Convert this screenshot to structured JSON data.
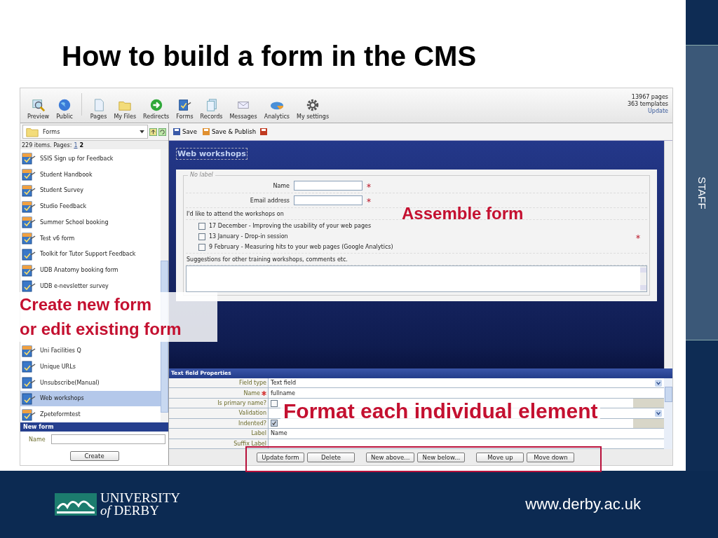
{
  "slide": {
    "title": "How to build a form in the CMS",
    "side_label": "STAFF",
    "logo_line1": "UNIVERSITY",
    "logo_line2": "*of* DERBY",
    "url": "www.derby.ac.uk"
  },
  "toolbar": {
    "buttons": [
      {
        "label": "Preview",
        "kind": "preview"
      },
      {
        "label": "Public",
        "kind": "globe"
      },
      {
        "label": "Pages",
        "kind": "page"
      },
      {
        "label": "My Files",
        "kind": "folder"
      },
      {
        "label": "Redirects",
        "kind": "redirect"
      },
      {
        "label": "Forms",
        "kind": "form"
      },
      {
        "label": "Records",
        "kind": "records"
      },
      {
        "label": "Messages",
        "kind": "mail"
      },
      {
        "label": "Analytics",
        "kind": "analytics"
      },
      {
        "label": "My settings",
        "kind": "gear"
      }
    ],
    "stats": [
      "13967 pages",
      "363 templates"
    ],
    "update_link": "Update"
  },
  "folder_select": {
    "value": "Forms"
  },
  "editor_toolbar": [
    "Save",
    "Save & Publish"
  ],
  "list": {
    "summary": "229 items. Pages:",
    "pages": [
      {
        "label": "1",
        "selected": false
      },
      {
        "label": "2",
        "selected": true
      }
    ],
    "items": [
      {
        "label": "SSIS Sign up for Feedback",
        "kind": "tabbed",
        "selected": false
      },
      {
        "label": "Student Handbook",
        "kind": "tabbed",
        "selected": false
      },
      {
        "label": "Student Survey",
        "kind": "tabbed",
        "selected": false
      },
      {
        "label": "Studio Feedback",
        "kind": "tabbed",
        "selected": false
      },
      {
        "label": "Summer School booking",
        "kind": "tabbed",
        "selected": false
      },
      {
        "label": "Test v6 form",
        "kind": "tabbed",
        "selected": false
      },
      {
        "label": "Toolkit for Tutor Support Feedback",
        "kind": "plain",
        "selected": false
      },
      {
        "label": "UDB Anatomy booking form",
        "kind": "tabbed",
        "selected": false
      },
      {
        "label": "UDB e-nevsletter survey",
        "kind": "plain",
        "selected": false
      },
      {
        "label": "Uni Facilities Q",
        "kind": "tabbed",
        "selected": false
      },
      {
        "label": "Unique URLs",
        "kind": "plain",
        "selected": false
      },
      {
        "label": "Unsubscribe(Manual)",
        "kind": "plain",
        "selected": false
      },
      {
        "label": "Web workshops",
        "kind": "plain",
        "selected": true
      },
      {
        "label": "Zpeteformtest",
        "kind": "tabbed",
        "selected": false
      }
    ]
  },
  "new_form": {
    "title": "New form",
    "name_label": "Name",
    "button": "Create"
  },
  "form_preview": {
    "title": "Web workshops",
    "legend": "No label",
    "fields": [
      {
        "label": "Name",
        "required": true
      },
      {
        "label": "Email address",
        "required": true
      }
    ],
    "question": "I'd like to attend the workshops on",
    "question_required": true,
    "options": [
      {
        "label": "17 December - Improving the usability of your web pages",
        "checked": false
      },
      {
        "label": "13 January - Drop-in session",
        "checked": false
      },
      {
        "label": "9 February - Measuring hits to your web pages (Google Analytics)",
        "checked": false
      }
    ],
    "suggestions_label": "Suggestions for other training workshops, comments etc."
  },
  "properties": {
    "title": "Text field Properties",
    "rows": [
      {
        "label": "Field type",
        "kind": "select",
        "value": "Text field",
        "required": false
      },
      {
        "label": "Name",
        "kind": "text",
        "value": "fullname",
        "required": true
      },
      {
        "label": "Is primary name?",
        "kind": "checkbox",
        "checked": false,
        "required": false
      },
      {
        "label": "Validation",
        "kind": "select",
        "required": false
      },
      {
        "label": "Indented?",
        "kind": "checkbox",
        "checked": true,
        "required": false
      },
      {
        "label": "Label",
        "kind": "text",
        "value": "Name",
        "required": false
      },
      {
        "label": "Suffix Label",
        "kind": "text",
        "required": false
      }
    ]
  },
  "actions": [
    "Update form",
    "Delete",
    "New above...",
    "New below...",
    "Move up",
    "Move down"
  ],
  "callouts": {
    "assemble": "Assemble form",
    "create": "Create new form",
    "edit": "or edit existing form",
    "format": "Format each individual element"
  }
}
